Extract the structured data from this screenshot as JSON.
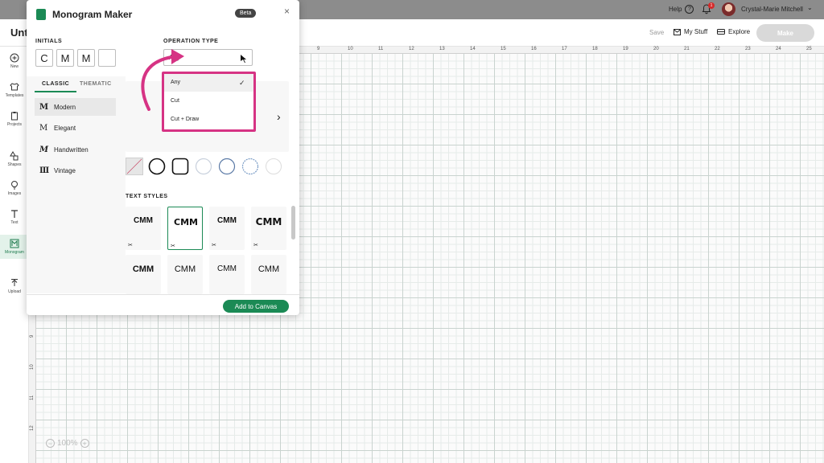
{
  "topbar": {
    "help_label": "Help",
    "help_icon": "?",
    "notification_count": "1",
    "user_name": "Crystal-Marie Mitchell",
    "chevron": "⌄"
  },
  "header": {
    "doc_title": "Unti",
    "save_label": "Save",
    "mystuff_label": "My Stuff",
    "explore_label": "Explore",
    "make_label": "Make"
  },
  "rail": {
    "items": [
      {
        "label": "New",
        "icon": "plus-circle-icon"
      },
      {
        "label": "Templates",
        "icon": "shirt-icon"
      },
      {
        "label": "Projects",
        "icon": "clipboard-icon"
      },
      {
        "label": "Shapes",
        "icon": "shapes-icon"
      },
      {
        "label": "Images",
        "icon": "bulb-icon"
      },
      {
        "label": "Text",
        "icon": "text-icon"
      },
      {
        "label": "Monogram",
        "icon": "monogram-icon"
      },
      {
        "label": "Upload",
        "icon": "upload-icon"
      }
    ]
  },
  "ruler": {
    "top": [
      "9",
      "10",
      "11",
      "12",
      "13",
      "14",
      "15",
      "16",
      "17",
      "18",
      "19",
      "20",
      "21",
      "22",
      "23",
      "24",
      "25"
    ],
    "left": [
      "9",
      "10",
      "11",
      "12"
    ]
  },
  "zoom": {
    "minus": "−",
    "value": "100%",
    "plus": "+"
  },
  "modal": {
    "title": "Monogram Maker",
    "beta": "Beta",
    "close": "×",
    "initials_label": "INITIALS",
    "initials": [
      "C",
      "M",
      "M",
      ""
    ],
    "operation_label": "OPERATION TYPE",
    "operation_value": "Any",
    "dropdown": {
      "options": [
        "Any",
        "Cut",
        "Cut + Draw"
      ],
      "selected": "Any",
      "check": "✓"
    },
    "tabs": {
      "classic": "CLASSIC",
      "thematic": "THEMATIC"
    },
    "styles": [
      {
        "glyph": "M",
        "label": "Modern"
      },
      {
        "glyph": "M",
        "label": "Elegant"
      },
      {
        "glyph": "M",
        "label": "Handwritten"
      },
      {
        "glyph": "Ⅲ",
        "label": "Vintage"
      }
    ],
    "next": "›",
    "text_styles_label": "TEXT STYLES",
    "text_styles": [
      "CMM",
      "CMM",
      "CMM",
      "CMM",
      "CMM",
      "CMM",
      "CMM",
      "CMM"
    ],
    "scissors": "✂",
    "add_button": "Add to Canvas"
  },
  "colors": {
    "brand_green": "#1b8a55",
    "highlight_pink": "#d63384",
    "topbar_gray": "#8c8c8c"
  }
}
